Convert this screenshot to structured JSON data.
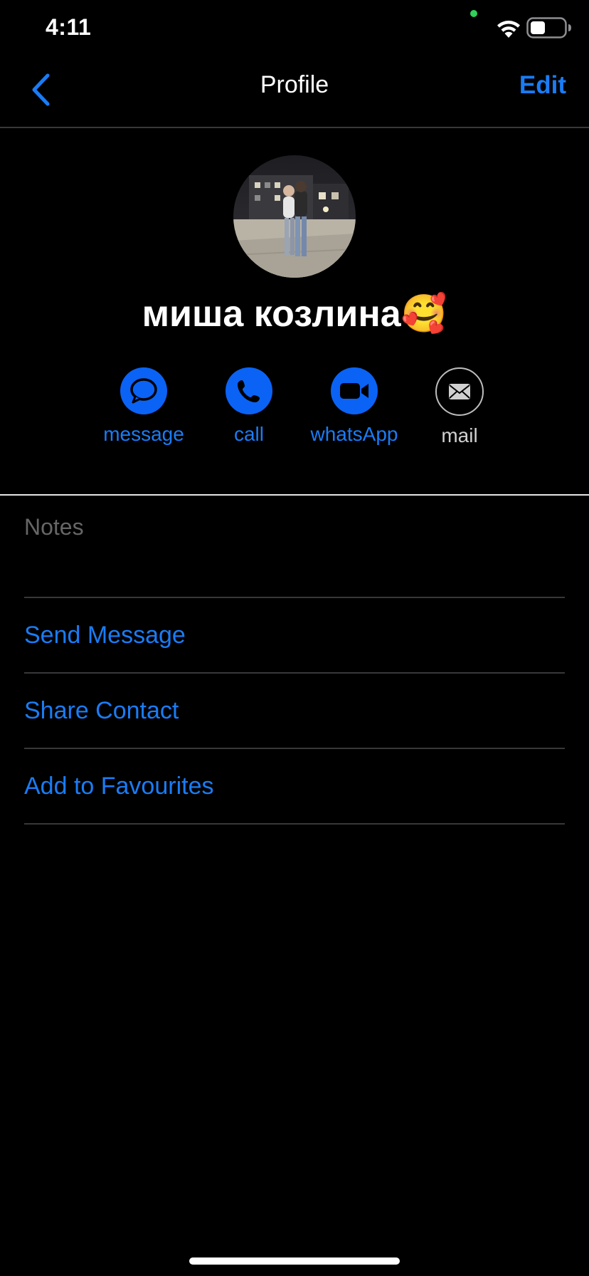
{
  "status_bar": {
    "time": "4:11",
    "privacy_indicator_color": "#30d158"
  },
  "nav": {
    "back_icon": "chevron-left-icon",
    "title": "Profile",
    "edit_label": "Edit"
  },
  "contact": {
    "name": "миша козлина🥰",
    "avatar": "contact-photo"
  },
  "actions": [
    {
      "label": "message",
      "icon": "message-bubble-icon",
      "enabled": true
    },
    {
      "label": "call",
      "icon": "phone-icon",
      "enabled": true
    },
    {
      "label": "whatsApp",
      "icon": "video-camera-icon",
      "enabled": true
    },
    {
      "label": "mail",
      "icon": "envelope-icon",
      "enabled": false
    }
  ],
  "notes": {
    "label": "Notes"
  },
  "options": [
    {
      "label": "Send Message"
    },
    {
      "label": "Share Contact"
    },
    {
      "label": "Add to Favourites"
    }
  ],
  "colors": {
    "accent": "#1a7cf5",
    "action_fill": "#0a63f5",
    "background": "#000000",
    "separator": "#38383a",
    "secondary_text": "#666668"
  }
}
